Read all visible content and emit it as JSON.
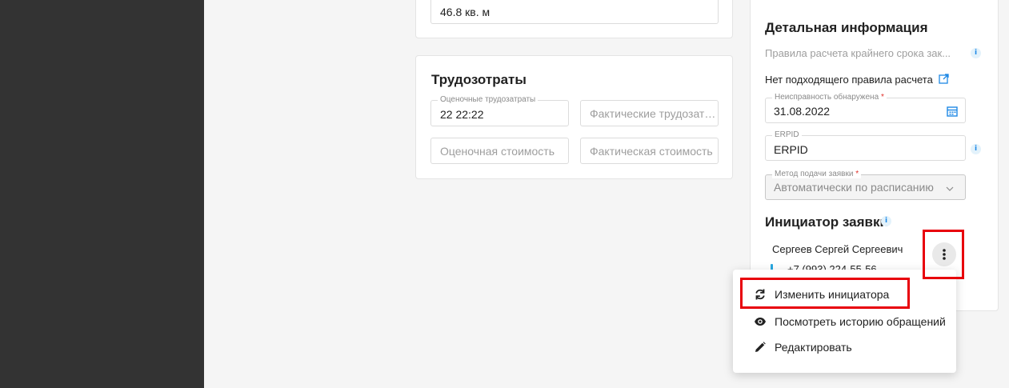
{
  "area_card": {
    "value": "46.8 кв. м"
  },
  "labor_card": {
    "title": "Трудозотраты",
    "estimated_labor_label": "Оценочные трудозатраты",
    "estimated_labor_value": "22 22:22",
    "actual_labor_placeholder": "Фактические трудозатр...",
    "estimated_cost_placeholder": "Оценочная стоимость",
    "actual_cost_placeholder": "Фактическая стоимость"
  },
  "details": {
    "title": "Детальная информация",
    "deadline_rules_text": "Правила расчета крайнего срока зак...",
    "no_rule_link": "Нет подходящего правила расчета",
    "fault_found_label": "Неисправность обнаружена",
    "fault_found_value": "31.08.2022",
    "erpid_label": "ERPID",
    "erpid_value": "ERPID",
    "submit_method_label": "Метод подачи заявки",
    "submit_method_value": "Автоматически по расписанию",
    "required_mark": "*"
  },
  "initiator": {
    "title": "Инициатор заявки",
    "name": "Сергеев Сергей Сергеевич",
    "phone": "+7 (993) 224-55-56"
  },
  "context_menu": {
    "items": [
      {
        "label": "Изменить инициатора",
        "icon": "refresh-icon"
      },
      {
        "label": "Посмотреть историю обращений",
        "icon": "eye-icon"
      },
      {
        "label": "Редактировать",
        "icon": "pencil-icon"
      }
    ]
  },
  "colors": {
    "sidebar": "#333333",
    "highlight": "#e8000b",
    "link": "#1e88e5"
  }
}
